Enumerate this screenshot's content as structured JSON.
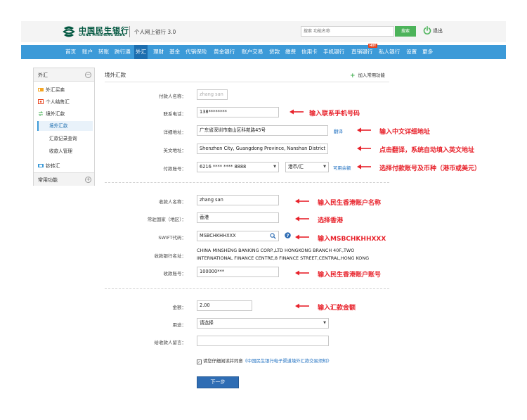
{
  "header": {
    "bank_name_cn": "中国民生银行",
    "bank_name_en": "CHINA MINSHENG BANK",
    "portal_title": "个人网上银行 3.0",
    "search_placeholder": "搜索 功能名称",
    "search_button": "搜索",
    "logout": "退出"
  },
  "nav": {
    "items": [
      "首页",
      "账户",
      "转账",
      "跨行通",
      "外汇",
      "理财",
      "基金",
      "代销保险",
      "黄金银行",
      "账户交易",
      "贷款",
      "缴费",
      "信用卡",
      "手机银行",
      "直销银行",
      "私人银行",
      "设置",
      "更多"
    ],
    "active_index": 4,
    "hot_badge": "HOT"
  },
  "sidebar": {
    "section_title": "外汇",
    "section_toggle": "−",
    "items": [
      "外汇买卖",
      "个人结售汇",
      "境外汇款"
    ],
    "sub_items": [
      "境外汇款",
      "汇款记录查询",
      "收款人管理"
    ],
    "active_sub_index": 0,
    "extra_item": "钞转汇",
    "footer_title": "常用功能",
    "footer_toggle": "+"
  },
  "main": {
    "title": "境外汇款",
    "add_function": "加入常用功能",
    "payer_name_label": "付款人名称：",
    "payer_name_value": "zhang san",
    "phone_label": "联系电话：",
    "phone_value": "138********",
    "address_label": "详细地址：",
    "address_value": "广东省深圳市南山区科苑路45号",
    "translate_link": "翻译",
    "english_address_label": "英文地址：",
    "english_address_value": "Shenzhen City, Guangdong Province, Nanshan District",
    "account_label": "付款账号：",
    "account_value": "6216 **** **** 8888",
    "currency_value": "港币/汇",
    "balance_link": "可用余额",
    "payee_name_label": "收款人名称：",
    "payee_name_value": "zhang san",
    "country_label": "常驻国家（地区）：",
    "country_value": "香港",
    "swift_label": "SWIFT代码：",
    "swift_value": "MSBCHKHHXXX",
    "bank_name_label": "收款银行名址：",
    "bank_name_line1": "CHINA MINSHENG BANKING CORP.,LTD HONGKONG BRANCH 40F.,TWO",
    "bank_name_line2": "INTERNATIONAL FINANCE CENTRE,8 FINANCE STREET,CENTRAL,HONG KONG",
    "payee_account_label": "收款账号：",
    "payee_account_value": "100000***",
    "amount_label": "金额：",
    "amount_value": "2.00",
    "purpose_label": "用途：",
    "purpose_value": "请选择",
    "message_label": "给收款人留言：",
    "message_value": "",
    "agree_text": "请您仔细阅读并同意",
    "agree_link": "《中国民生银行电子渠道境外汇款交易须知》",
    "agree_mark": "✓",
    "submit": "下一步"
  },
  "annotations": {
    "phone": "输入联系手机号码",
    "address": "输入中文详细地址",
    "translate": "点击翻译，系统自动填入英文地址",
    "account": "选择付款账号及币种（港币或美元）",
    "payee_name": "输入民生香港账户名称",
    "country": "选择香港",
    "swift": "输入MSBCHKHHXXX",
    "payee_account": "输入民生香港账户账号",
    "amount": "输入汇款金额"
  },
  "colors": {
    "nav_bg": "#3c9ad8",
    "nav_active": "#1d6eaf",
    "brand_green": "#00563f",
    "search_green": "#4cb35a",
    "annotation_red": "#e8222b",
    "link_blue": "#1e6fc0",
    "submit_blue": "#2f6db4"
  }
}
